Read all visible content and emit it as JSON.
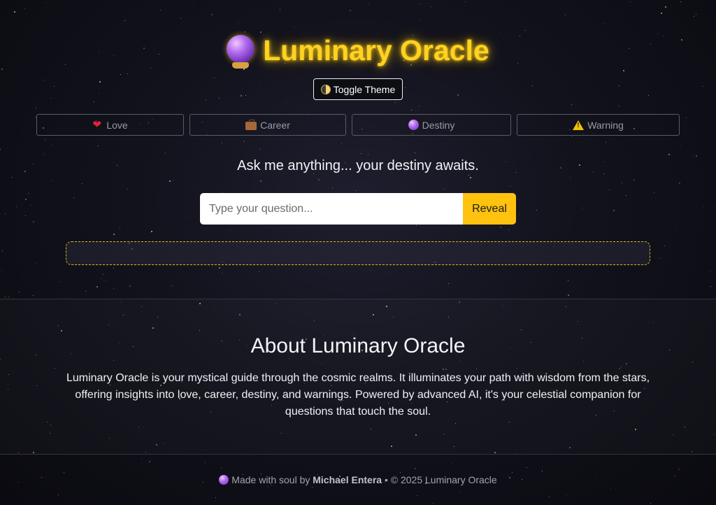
{
  "header": {
    "title": "Luminary Oracle",
    "title_icon": "crystal-ball-icon",
    "title_color": "#ffd21f",
    "theme_toggle_label": "Toggle Theme",
    "theme_toggle_icon": "half-moon-icon"
  },
  "categories": [
    {
      "label": "Love",
      "icon": "heart-icon"
    },
    {
      "label": "Career",
      "icon": "briefcase-icon"
    },
    {
      "label": "Destiny",
      "icon": "crystal-ball-icon"
    },
    {
      "label": "Warning",
      "icon": "warning-icon"
    }
  ],
  "oracle": {
    "prompt": "Ask me anything... your destiny awaits.",
    "input_placeholder": "Type your question...",
    "input_value": "",
    "reveal_label": "Reveal",
    "accent_color": "#ffc20e",
    "answer": ""
  },
  "about": {
    "title": "About Luminary Oracle",
    "text": "Luminary Oracle is your mystical guide through the cosmic realms. It illuminates your path with wisdom from the stars, offering insights into love, career, destiny, and warnings. Powered by advanced AI, it's your celestial companion for questions that touch the soul."
  },
  "footer": {
    "prefix": "Made with soul by",
    "author": "Michael Entera",
    "suffix": "• © 2025 Luminary Oracle"
  }
}
